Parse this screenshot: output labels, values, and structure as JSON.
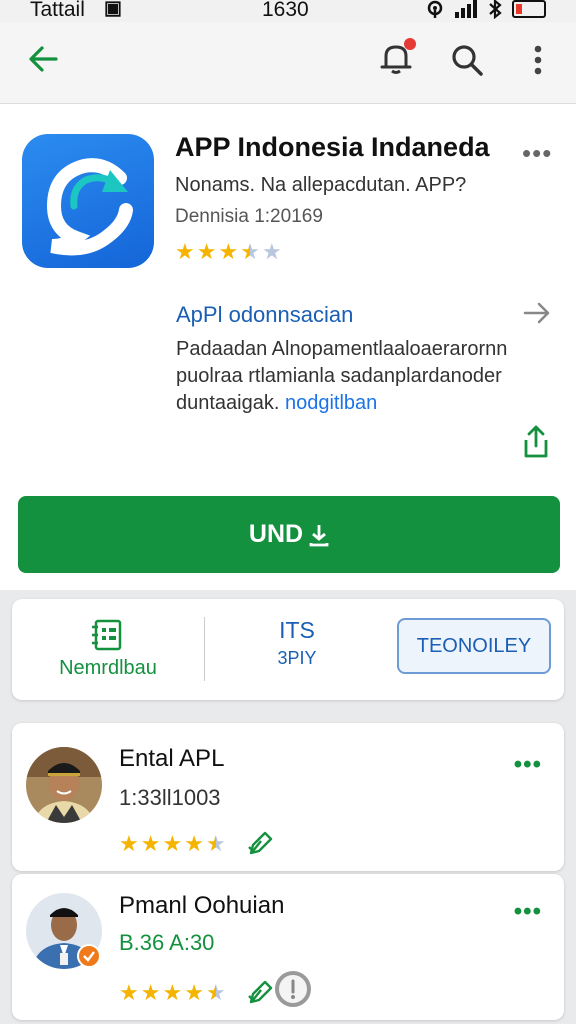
{
  "status_bar": {
    "carrier": "Tattail",
    "time": "1630"
  },
  "app": {
    "title": "APP Indonesia Indaneda",
    "subtitle": "Nonams. Na allepacdutan. APP?",
    "developer": "Dennisia 1:20169",
    "rating": 3.5,
    "about_title": "ApPl odonnsacian",
    "about_lines": [
      "Padaadan Alnopamentlaaloaerarornn",
      "puolraa rtlamianla sadanplardanoder"
    ],
    "about_line3": "duntaaigak.",
    "about_link": "nodgitlban",
    "install_label": "UND"
  },
  "info": {
    "left_label": "Nemrdlbau",
    "mid_value": "ITS",
    "mid_label": "3PIY",
    "tag_label": "TEONOILEY"
  },
  "reviews": [
    {
      "name": "Ental APL",
      "date": "1:33ll1003",
      "rating": 4.5
    },
    {
      "name": "Pmanl Oohuian",
      "date": "B.36 A:30",
      "rating": 4.5
    }
  ],
  "colors": {
    "accent_green": "#14913f",
    "link_blue": "#1a5fb4",
    "star_gold": "#f4b400"
  }
}
